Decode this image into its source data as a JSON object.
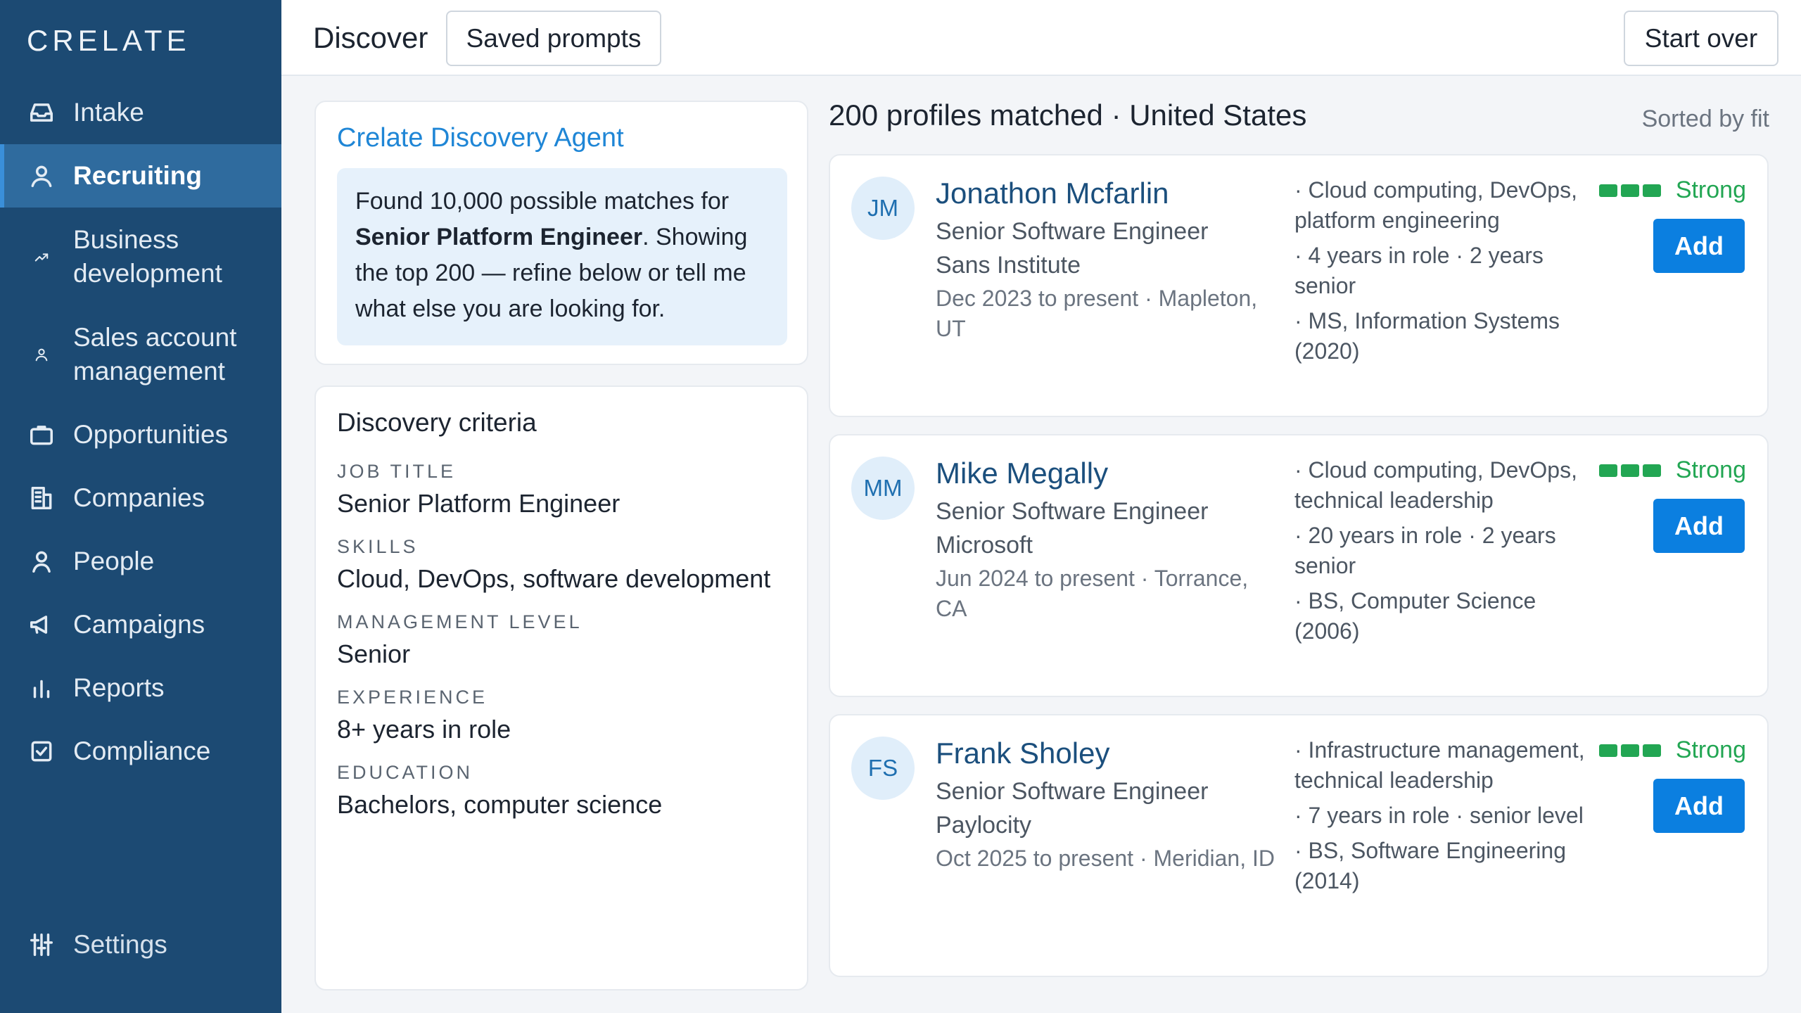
{
  "app": {
    "logo": "CRELATE"
  },
  "sidebar": {
    "items": [
      {
        "label": "Intake",
        "icon": "inbox-icon"
      },
      {
        "label": "Recruiting",
        "icon": "person-icon",
        "active": true
      },
      {
        "label": "Business development",
        "icon": "trend-up-icon"
      },
      {
        "label": "Sales account management",
        "icon": "person-small-icon"
      },
      {
        "label": "Opportunities",
        "icon": "briefcase-icon"
      },
      {
        "label": "Companies",
        "icon": "building-icon"
      },
      {
        "label": "People",
        "icon": "person-icon"
      },
      {
        "label": "Campaigns",
        "icon": "megaphone-icon"
      },
      {
        "label": "Reports",
        "icon": "bar-chart-icon"
      },
      {
        "label": "Compliance",
        "icon": "checkbox-icon"
      }
    ],
    "settings": {
      "label": "Settings",
      "icon": "sliders-icon"
    }
  },
  "topbar": {
    "title": "Discover",
    "saved_prompts_label": "Saved prompts",
    "start_over_label": "Start over"
  },
  "agent": {
    "title": "Crelate Discovery Agent",
    "message_prefix": "Found 10,000 possible matches for ",
    "message_bold": "Senior Platform Engineer",
    "message_suffix": ". Showing the top 200 — refine below or tell me what else you are looking for."
  },
  "criteria": {
    "title": "Discovery criteria",
    "fields": [
      {
        "label": "JOB TITLE",
        "value": "Senior Platform Engineer"
      },
      {
        "label": "SKILLS",
        "value": "Cloud, DevOps, software development"
      },
      {
        "label": "MANAGEMENT LEVEL",
        "value": "Senior"
      },
      {
        "label": "EXPERIENCE",
        "value": "8+ years in role"
      },
      {
        "label": "EDUCATION",
        "value": "Bachelors, computer science"
      }
    ]
  },
  "results": {
    "header": "200 profiles matched · United States",
    "sorted": "Sorted by fit",
    "profiles": [
      {
        "initials": "JM",
        "name": "Jonathon Mcfarlin",
        "title": "Senior Software Engineer",
        "company": "Sans Institute",
        "dates": "Dec 2023 to present · Mapleton, UT",
        "details": [
          "· Cloud computing, DevOps, platform engineering",
          "· 4 years in role · 2 years senior",
          "· MS, Information Systems (2020)"
        ],
        "strength": "Strong",
        "add_label": "Add"
      },
      {
        "initials": "MM",
        "name": "Mike Megally",
        "title": "Senior Software Engineer",
        "company": "Microsoft",
        "dates": "Jun 2024 to present · Torrance, CA",
        "details": [
          "· Cloud computing, DevOps, technical leadership",
          "· 20 years in role · 2 years senior",
          "· BS, Computer Science (2006)"
        ],
        "strength": "Strong",
        "add_label": "Add"
      },
      {
        "initials": "FS",
        "name": "Frank Sholey",
        "title": "Senior Software Engineer",
        "company": "Paylocity",
        "dates": "Oct 2025 to present · Meridian, ID",
        "details": [
          "· Infrastructure management, technical leadership",
          "· 7 years in role · senior level",
          "· BS, Software Engineering (2014)"
        ],
        "strength": "Strong",
        "add_label": "Add"
      }
    ]
  },
  "colors": {
    "sidebar": "#1c4a73",
    "active": "#2f6b9e",
    "accent": "#0b7fe0",
    "strong": "#22a653",
    "link": "#1f86d6"
  }
}
